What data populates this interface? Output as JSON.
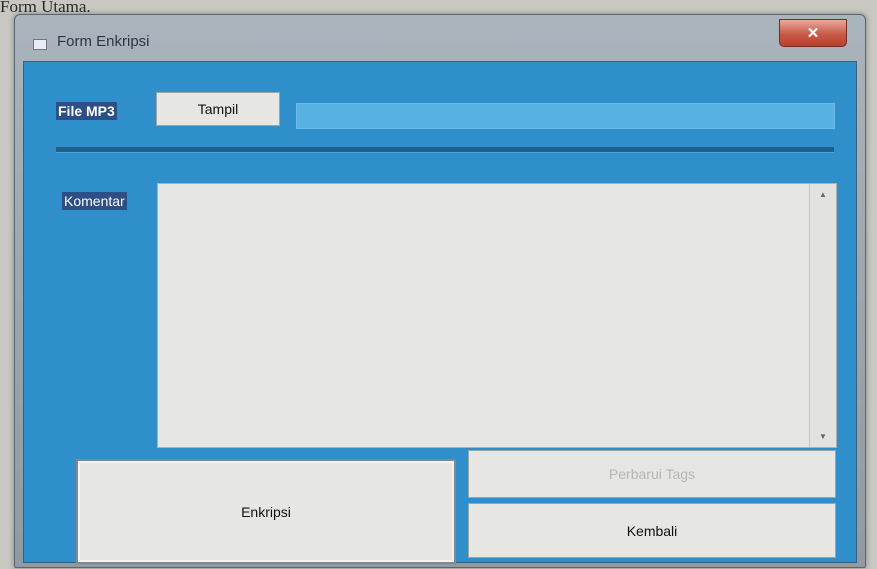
{
  "caption": "Form Utama.",
  "window": {
    "title": "Form Enkripsi",
    "close_label": "✕"
  },
  "form": {
    "file_label": "File MP3",
    "tampil_label": "Tampil",
    "file_value": "",
    "komentar_label": "Komentar",
    "komentar_value": "",
    "enkripsi_label": "Enkripsi",
    "perbarui_label": "Perbarui Tags",
    "kembali_label": "Kembali"
  },
  "colors": {
    "client_background": "#2f8fca",
    "button_face": "#e6e6e3",
    "label_highlight": "#2d4f86",
    "close_button": "#c85a47"
  }
}
